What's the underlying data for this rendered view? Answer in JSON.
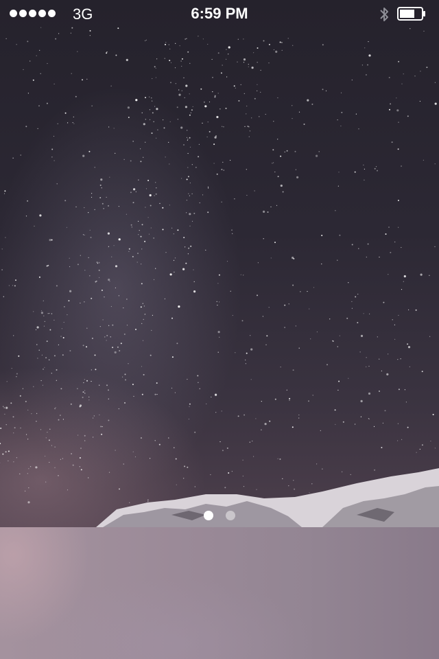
{
  "status_bar": {
    "signal_strength": 5,
    "carrier": "3G",
    "time": "6:59 PM",
    "bluetooth_icon": "bluetooth-icon",
    "battery_level": 0.7
  },
  "home": {
    "wallpaper": "starry-night-sky-over-snowy-mountain",
    "page_count": 2,
    "current_page": 1
  },
  "dock": {
    "items": []
  },
  "colors": {
    "status_text": "#ffffff",
    "dock": "#9b8a98"
  }
}
